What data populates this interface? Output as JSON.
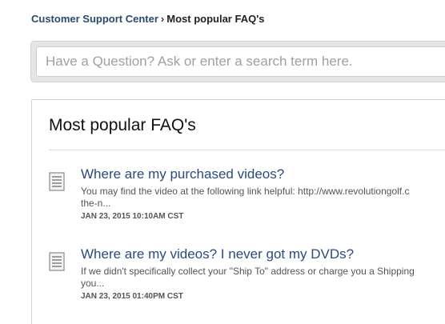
{
  "breadcrumb": {
    "parent": "Customer Support Center",
    "separator": "›",
    "current": "Most popular FAQ's"
  },
  "search": {
    "placeholder": "Have a Question? Ask or enter a search term here.",
    "value": ""
  },
  "panel": {
    "title": "Most popular FAQ's",
    "items": [
      {
        "icon": "document-icon",
        "title": "Where are my purchased videos?",
        "excerpt_line1": "You may find the video at the following link helpful: http://www.revolutiongolf.c",
        "excerpt_line2": "the-n...",
        "date": "JAN 23, 2015 10:10AM CST"
      },
      {
        "icon": "document-icon",
        "title": "Where are my videos? I never got my DVDs?",
        "excerpt_line1": "If we didn't specifically collect your \"Ship To\" address or charge you a Shipping",
        "excerpt_line2": "you...",
        "date": "JAN 23, 2015 01:40PM CST"
      }
    ]
  }
}
